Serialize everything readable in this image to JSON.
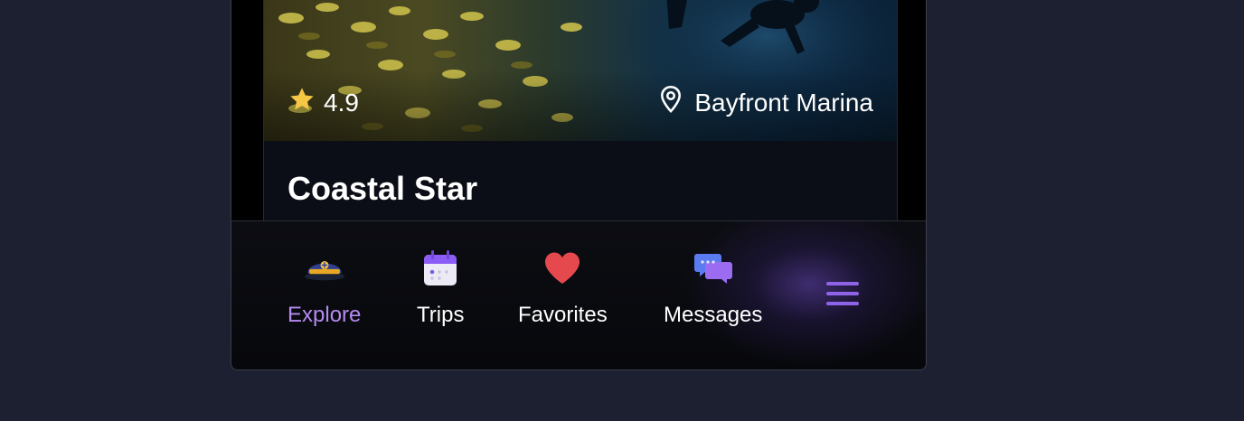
{
  "listing": {
    "rating": "4.9",
    "location": "Bayfront Marina",
    "title": "Coastal Star"
  },
  "nav": {
    "items": [
      {
        "label": "Explore",
        "icon": "captain-hat-icon",
        "active": true
      },
      {
        "label": "Trips",
        "icon": "calendar-icon",
        "active": false
      },
      {
        "label": "Favorites",
        "icon": "heart-icon",
        "active": false
      },
      {
        "label": "Messages",
        "icon": "chat-bubbles-icon",
        "active": false
      }
    ],
    "menu_icon": "hamburger-menu-icon"
  },
  "colors": {
    "background": "#1d2030",
    "accent": "#b58af0",
    "star": "#f6c744",
    "heart": "#e5484d"
  }
}
